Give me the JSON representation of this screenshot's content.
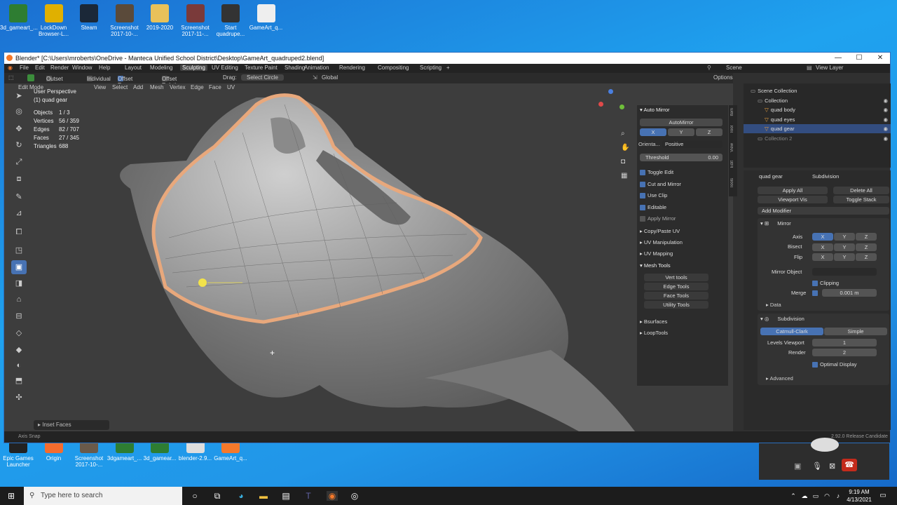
{
  "desktop": {
    "top_icons": [
      {
        "label": "3d_gameart_...",
        "color": "#2e7d32"
      },
      {
        "label": "LockDown Browser-L...",
        "color": "#e0b000"
      },
      {
        "label": "Steam",
        "color": "#1b2838"
      },
      {
        "label": "Screenshot 2017-10-...",
        "color": "#5a4a3a"
      },
      {
        "label": "2019-2020",
        "color": "#e8c15a"
      },
      {
        "label": "Screenshot 2017-11-...",
        "color": "#7a3a3a"
      },
      {
        "label": "Start quadrupe...",
        "color": "#333"
      },
      {
        "label": "GameArt_q...",
        "color": "#eeeeee"
      }
    ],
    "bottom_icons": [
      {
        "label": "Epic Games Launcher",
        "color": "#222"
      },
      {
        "label": "Origin",
        "color": "#f56c2d"
      },
      {
        "label": "Screenshot 2017-10-...",
        "color": "#6a5a4a"
      },
      {
        "label": "3dgameart_...",
        "color": "#2e7d32"
      },
      {
        "label": "3d_gamear...",
        "color": "#2e7d32"
      },
      {
        "label": "blender-2.9...",
        "color": "#ddd"
      },
      {
        "label": "GameArt_q...",
        "color": "#f5792a"
      }
    ]
  },
  "window": {
    "title": "Blender* [C:\\Users\\mroberts\\OneDrive - Manteca Unified School District\\Desktop\\GameArt_quadruped2.blend]",
    "min": "—",
    "max": "☐",
    "close": "✕"
  },
  "menu": [
    "File",
    "Edit",
    "Render",
    "Window",
    "Help"
  ],
  "workspaces": [
    "Layout",
    "Modeling",
    "Sculpting",
    "UV Editing",
    "Texture Paint",
    "Shading",
    "Animation",
    "Rendering",
    "Compositing",
    "Scripting",
    "+"
  ],
  "active_workspace": "Sculpting",
  "scene": "Scene",
  "view_layer": "View Layer",
  "tool_header": {
    "options": [
      "Outset",
      "Individual",
      "Offset Even",
      "Offset Relative"
    ],
    "drag_label": "Drag:",
    "drag_value": "Select Circle",
    "orientation": "Global",
    "options_btn": "Options"
  },
  "view_header": {
    "mode": "Edit Mode",
    "menus": [
      "View",
      "Select",
      "Add",
      "Mesh",
      "Vertex",
      "Edge",
      "Face",
      "UV"
    ]
  },
  "overlay_text": {
    "perspective": "User Perspective",
    "object": "(1) quad gear",
    "stats": [
      {
        "k": "Objects",
        "v": "1 / 3"
      },
      {
        "k": "Vertices",
        "v": "56 / 359"
      },
      {
        "k": "Edges",
        "v": "82 / 707"
      },
      {
        "k": "Faces",
        "v": "27 / 345"
      },
      {
        "k": "Triangles",
        "v": "688"
      }
    ]
  },
  "last_op": "Inset Faces",
  "npanel": {
    "tabs": [
      "Item",
      "Tool",
      "View",
      "Edit",
      "Tools"
    ],
    "automirror_title": "Auto Mirror",
    "automirror_btn": "AutoMirror",
    "axes": [
      "X",
      "Y",
      "Z"
    ],
    "orientation_label": "Orienta...",
    "orientation_value": "Positive",
    "threshold_label": "Threshold",
    "threshold_value": "0.00",
    "checks": [
      {
        "label": "Toggle Edit",
        "on": true
      },
      {
        "label": "Cut and Mirror",
        "on": true
      },
      {
        "label": "Use Clip",
        "on": true
      },
      {
        "label": "Editable",
        "on": true
      },
      {
        "label": "Apply Mirror",
        "on": false
      }
    ],
    "sections": [
      "Copy/Paste UV",
      "UV Manipulation",
      "UV Mapping"
    ],
    "mesh_tools_title": "Mesh Tools",
    "mesh_tools": [
      "Vert tools",
      "Edge Tools",
      "Face Tools",
      "Utility Tools"
    ],
    "extra_sections": [
      "Bsurfaces",
      "LoopTools"
    ]
  },
  "outliner": {
    "items": [
      {
        "label": "Scene Collection",
        "indent": 0,
        "selected": false
      },
      {
        "label": "Collection",
        "indent": 1,
        "selected": false
      },
      {
        "label": "quad body",
        "indent": 2,
        "selected": false
      },
      {
        "label": "quad eyes",
        "indent": 2,
        "selected": false
      },
      {
        "label": "quad gear",
        "indent": 2,
        "selected": true
      },
      {
        "label": "Collection 2",
        "indent": 1,
        "selected": false
      }
    ]
  },
  "properties": {
    "object": "quad gear",
    "modifier_label": "Subdivision",
    "apply_all": "Apply All",
    "delete_all": "Delete All",
    "viewport_vis": "Viewport Vis",
    "toggle_stack": "Toggle Stack",
    "add_modifier": "Add Modifier",
    "mirror": {
      "name": "Mirror",
      "axis_label": "Axis",
      "bisect_label": "Bisect",
      "flip_label": "Flip",
      "axes": [
        "X",
        "Y",
        "Z"
      ],
      "mirror_object_label": "Mirror Object",
      "clipping": "Clipping",
      "merge_label": "Merge",
      "merge_value": "0.001 m",
      "data_label": "Data"
    },
    "subdivision": {
      "name": "Subdivision",
      "catmull": "Catmull-Clark",
      "simple": "Simple",
      "levels_label": "Levels Viewport",
      "levels_value": "1",
      "render_label": "Render",
      "render_value": "2",
      "optimal": "Optimal Display",
      "advanced": "Advanced"
    }
  },
  "statusbar": {
    "left": "Axis Snap",
    "right": "2.92.0 Release Candidate"
  },
  "taskbar": {
    "search_placeholder": "Type here to search",
    "time": "9:19 AM",
    "date": "4/13/2021"
  },
  "colors": {
    "accent_blue": "#4772b3",
    "selection_orange": "#e8a87c",
    "desktop": "#1e8ee6"
  }
}
